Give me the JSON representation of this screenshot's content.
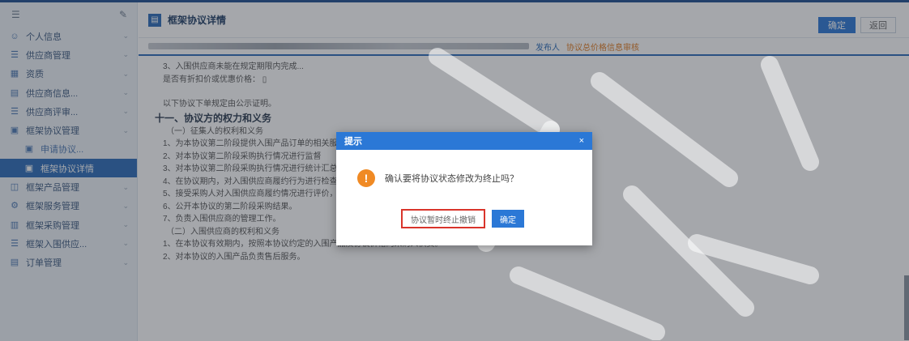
{
  "app": {
    "menu_icon": "hamburger-icon",
    "pin_icon": "pin-icon"
  },
  "sidebar": {
    "items": [
      {
        "label": "个人信息",
        "icon": "user-icon",
        "type": "group"
      },
      {
        "label": "供应商管理",
        "icon": "list-icon",
        "type": "group"
      },
      {
        "label": "资质",
        "icon": "grid-icon",
        "type": "group"
      },
      {
        "label": "供应商信息...",
        "icon": "doc-icon",
        "type": "group"
      },
      {
        "label": "供应商评审...",
        "icon": "list-icon",
        "type": "group"
      },
      {
        "label": "框架协议管理",
        "icon": "folder-icon",
        "type": "group"
      },
      {
        "label": "申请协议...",
        "icon": "folder-icon",
        "type": "sub"
      },
      {
        "label": "框架协议详情",
        "icon": "folder-icon",
        "type": "active"
      },
      {
        "label": "框架产品管理",
        "icon": "box-icon",
        "type": "group"
      },
      {
        "label": "框架服务管理",
        "icon": "gear-icon",
        "type": "group"
      },
      {
        "label": "框架采购管理",
        "icon": "cart-icon",
        "type": "group"
      },
      {
        "label": "框架入围供应...",
        "icon": "list-icon",
        "type": "group"
      },
      {
        "label": "订单管理",
        "icon": "doc-icon",
        "type": "group"
      }
    ]
  },
  "header": {
    "title": "框架协议详情",
    "primary_button": "确定",
    "secondary_button": "返回"
  },
  "tabs": {
    "link1": "发布人",
    "link2": "协议总价格信息审核"
  },
  "content": {
    "lines": [
      {
        "text": "3、入围供应商未能在规定期限内完成...",
        "style": "indent"
      },
      {
        "text": "是否有折扣价或优惠价格： ▯",
        "style": "indent"
      },
      {
        "text": "",
        "style": "spacer"
      },
      {
        "text": "以下协议下单规定由公示证明。",
        "style": "indent"
      },
      {
        "text": "十一、协议方的权力和义务",
        "style": "heading"
      },
      {
        "text": "（一）征集人的权利和义务",
        "style": "sec"
      },
      {
        "text": "1、为本协议第二阶段提供入围产品订单的相关服务",
        "style": "indent"
      },
      {
        "text": "2、对本协议第二阶段采购执行情况进行监督",
        "style": "indent"
      },
      {
        "text": "3、对本协议第二阶段采购执行情况进行统计汇总",
        "style": "indent"
      },
      {
        "text": "4、在协议期内，对入围供应商履约行为进行检查，发现违约情况的按约定处理。",
        "style": "indent"
      },
      {
        "text": "5、接受采购人对入围供应商履约情况进行评价，并对评价结果进行公示，作为第二阶段确定成交供应商的依据参考。",
        "style": "indent"
      },
      {
        "text": "6、公开本协议的第二阶段采购结果。",
        "style": "indent"
      },
      {
        "text": "7、负责入围供应商的管理工作。",
        "style": "indent"
      },
      {
        "text": "（二）入围供应商的权利和义务",
        "style": "sec"
      },
      {
        "text": "1、在本协议有效期内，按照本协议约定的入围产品及协议价格向采购人供货。",
        "style": "indent"
      },
      {
        "text": "2、对本协议的入围产品负责售后服务。",
        "style": "indent"
      }
    ]
  },
  "dialog": {
    "title": "提示",
    "close": "×",
    "message": "确认要将协议状态修改为终止吗？",
    "cancel_button": "协议暂时终止撤销",
    "ok_button": "确定",
    "warning_icon": "warning-icon",
    "warning_glyph": "!"
  },
  "colors": {
    "brand": "#2b6cb8",
    "accent_orange": "#f08a24",
    "highlight_red": "#d9342b"
  }
}
